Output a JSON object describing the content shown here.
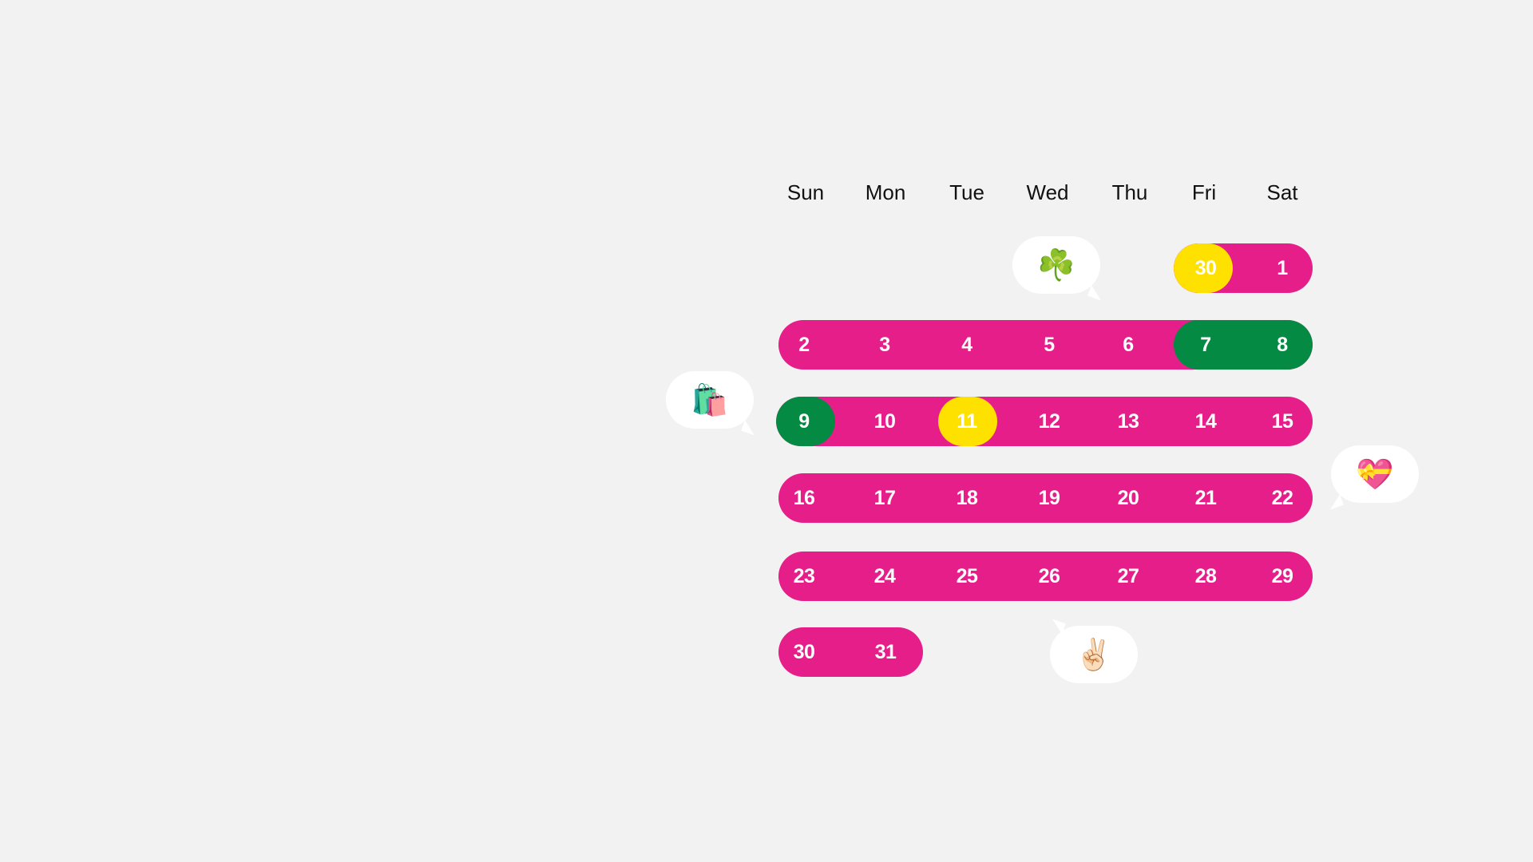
{
  "calendar": {
    "weekdays": [
      "Sun",
      "Mon",
      "Tue",
      "Wed",
      "Thu",
      "Fri",
      "Sat"
    ],
    "weeks": [
      [
        "",
        "",
        "",
        "",
        "",
        "30",
        "1"
      ],
      [
        "2",
        "3",
        "4",
        "5",
        "6",
        "7",
        "8"
      ],
      [
        "9",
        "10",
        "11",
        "12",
        "13",
        "14",
        "15"
      ],
      [
        "16",
        "17",
        "18",
        "19",
        "20",
        "21",
        "22"
      ],
      [
        "23",
        "24",
        "25",
        "26",
        "27",
        "28",
        "29"
      ],
      [
        "30",
        "31",
        "",
        "",
        "",
        "",
        ""
      ]
    ],
    "highlights": {
      "yellow": [
        "30 (week 1)",
        "11"
      ],
      "green": [
        "7",
        "8",
        "9"
      ]
    }
  },
  "colors": {
    "background": "#f2f2f2",
    "range_pink": "#e61e8a",
    "highlight_green": "#048a43",
    "highlight_yellow": "#ffe100",
    "day_text": "#ffffff",
    "weekday_text": "#111111",
    "bubble": "#ffffff"
  },
  "bubbles": [
    {
      "icon": "shamrock-icon",
      "glyph": "☘️"
    },
    {
      "icon": "shopping-bags-icon",
      "glyph": "🛍️"
    },
    {
      "icon": "heart-with-ribbon-icon",
      "glyph": "💝"
    },
    {
      "icon": "victory-hand-icon",
      "glyph": "✌🏻"
    }
  ]
}
